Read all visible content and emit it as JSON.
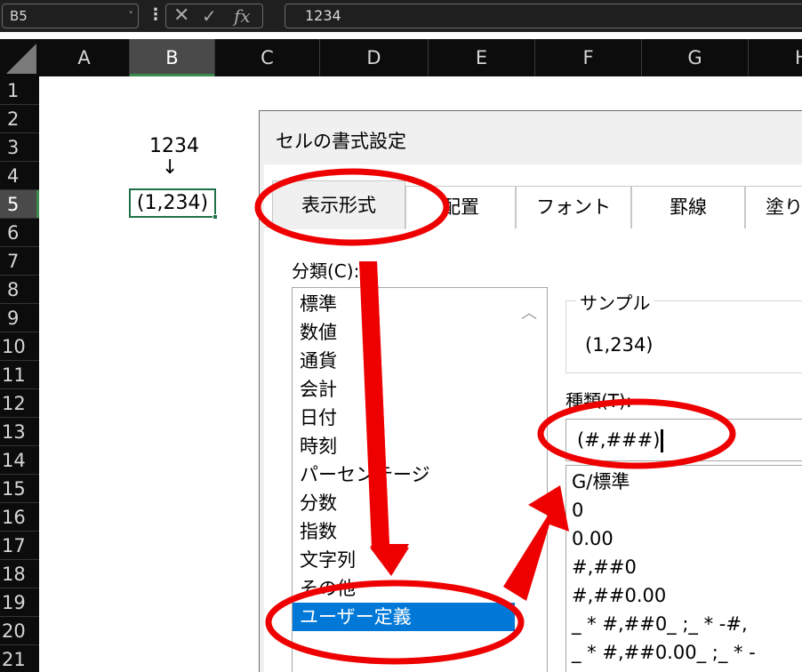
{
  "formula_bar": {
    "name_box": "B5",
    "name_box_arrow": "˅",
    "menu_glyph": "⋮",
    "cancel_glyph": "✕",
    "enter_glyph": "✓",
    "fx_glyph": "fx",
    "formula": "1234"
  },
  "columns": [
    "A",
    "B",
    "C",
    "D",
    "E",
    "F",
    "G",
    "H"
  ],
  "rows": [
    "1",
    "2",
    "3",
    "4",
    "5",
    "6",
    "7",
    "8",
    "9",
    "10",
    "11",
    "12",
    "13",
    "14",
    "15",
    "16",
    "17",
    "18",
    "19",
    "20",
    "21"
  ],
  "selected_column": "B",
  "selected_row": "5",
  "sheet": {
    "b3_text": "1234",
    "b4_arrow": "↓",
    "b5_text": "(1,234)"
  },
  "dialog": {
    "title": "セルの書式設定",
    "tabs": [
      "表示形式",
      "配置",
      "フォント",
      "罫線",
      "塗りつ"
    ],
    "category_label": "分類(C):",
    "categories": [
      "標準",
      "数値",
      "通貨",
      "会計",
      "日付",
      "時刻",
      "パーセンテージ",
      "分数",
      "指数",
      "文字列",
      "その他",
      "ユーザー定義"
    ],
    "selected_category": "ユーザー定義",
    "scroll_up_glyph": "︿",
    "sample_label": "サンプル",
    "sample_value": "(1,234)",
    "type_label": "種類(T):",
    "type_value": "(#,###)",
    "format_list": [
      "G/標準",
      "0",
      "0.00",
      "#,##0",
      "#,##0.00",
      "_ * #,##0_ ;_ * -#,",
      "_ * #,##0.00_ ;_ * -"
    ]
  },
  "colors": {
    "annotation": "#ee0000",
    "selection_blue": "#0078d7",
    "cell_border_green": "#1e7145"
  }
}
